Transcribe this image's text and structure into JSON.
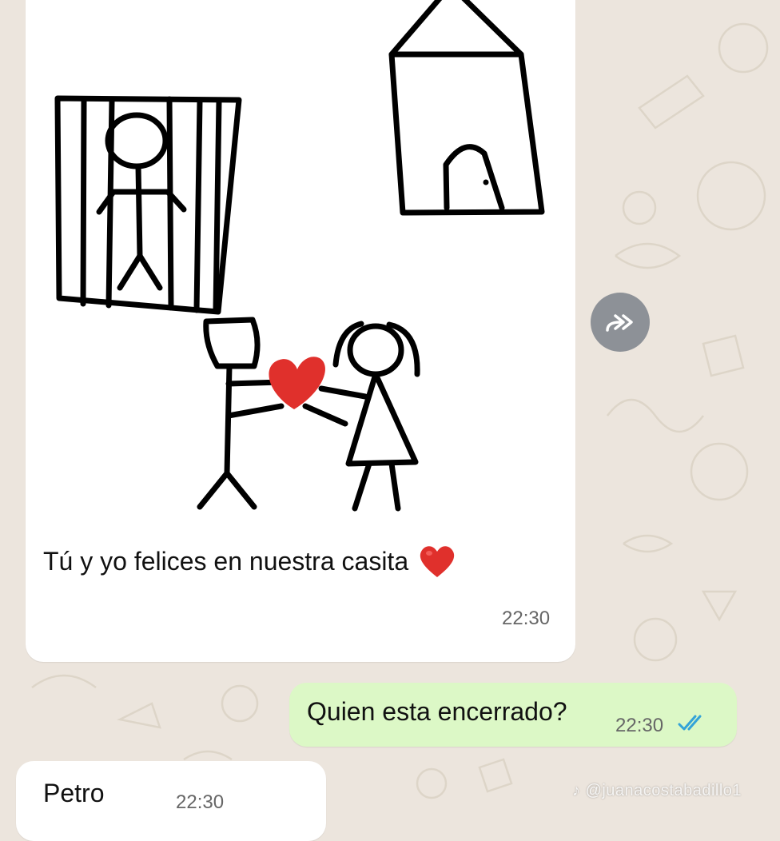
{
  "colors": {
    "chat_background": "#ece5dd",
    "incoming_bubble": "#ffffff",
    "outgoing_bubble": "#dcf8c6",
    "heart": "#e0302c",
    "read_ticks": "#34a3d8",
    "forward_button": "#8d9197"
  },
  "messages": [
    {
      "direction": "incoming",
      "type": "image",
      "image_description_icons": [
        "jail-cell-drawing",
        "house-drawing",
        "couple-with-heart-drawing"
      ],
      "caption": "Tú y yo felices en nuestra casita",
      "caption_emoji": "red-heart",
      "time": "22:30"
    },
    {
      "direction": "outgoing",
      "text": "Quien esta encerrado?",
      "time": "22:30",
      "status_icon": "double-check-read"
    },
    {
      "direction": "incoming",
      "text": "Petro",
      "time": "22:30"
    }
  ],
  "forward_button": {
    "icon": "double-forward-arrow-icon"
  },
  "watermark": "@juanacostabadillo1"
}
